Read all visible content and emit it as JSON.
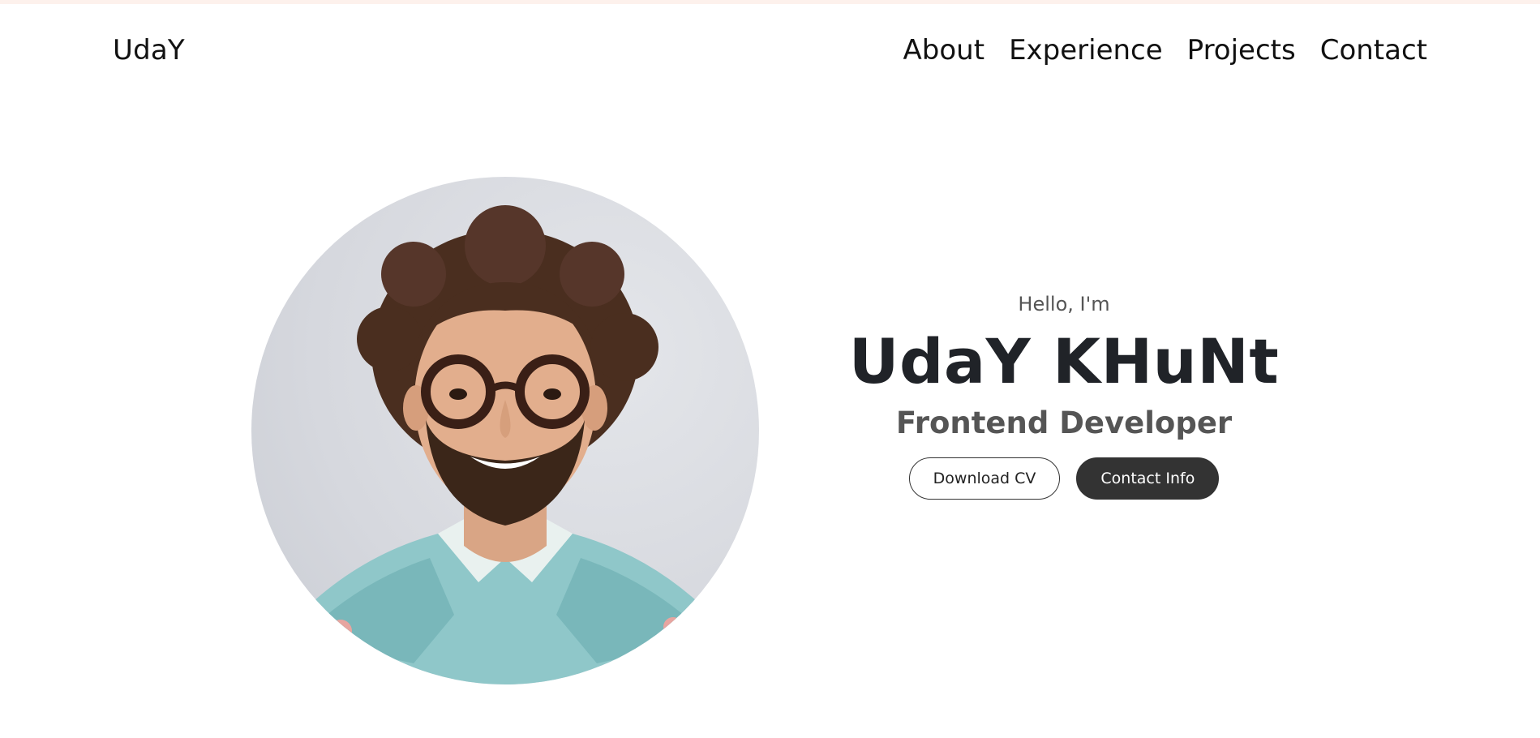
{
  "header": {
    "brand": "UdaY",
    "nav": [
      "About",
      "Experience",
      "Projects",
      "Contact"
    ]
  },
  "hero": {
    "greeting": "Hello, I'm",
    "name": "UdaY KHuNt",
    "role": "Frontend Developer",
    "buttons": {
      "download_cv": "Download CV",
      "contact_info": "Contact Info"
    },
    "portrait_icon": "profile-photo"
  },
  "colors": {
    "text": "#111111",
    "heading": "#202328",
    "subtext": "#555555",
    "solid_button": "#333333",
    "top_strip": "#fdf1ec"
  }
}
